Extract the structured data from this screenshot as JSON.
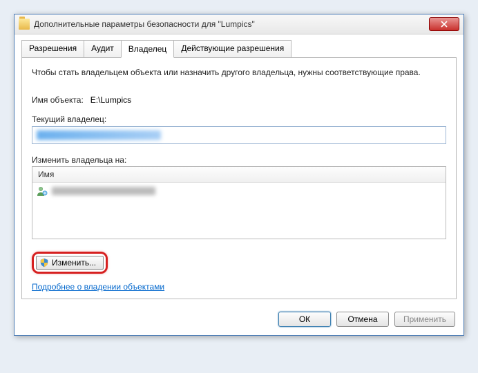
{
  "window": {
    "title": "Дополнительные параметры безопасности  для \"Lumpics\""
  },
  "tabs": {
    "permissions": "Разрешения",
    "audit": "Аудит",
    "owner": "Владелец",
    "effective": "Действующие разрешения"
  },
  "panel": {
    "intro": "Чтобы стать владельцем объекта или назначить другого владельца, нужны соответствующие права.",
    "object_name_label": "Имя объекта:",
    "object_name_value": "E:\\Lumpics",
    "current_owner_label": "Текущий владелец:",
    "current_owner_value": "████████████████",
    "change_owner_to_label": "Изменить владельца на:",
    "list_header_name": "Имя",
    "list_row_value": "████████████████",
    "change_button": "Изменить...",
    "learn_more_link": "Подробнее о владении объектами"
  },
  "footer": {
    "ok": "ОК",
    "cancel": "Отмена",
    "apply": "Применить"
  }
}
